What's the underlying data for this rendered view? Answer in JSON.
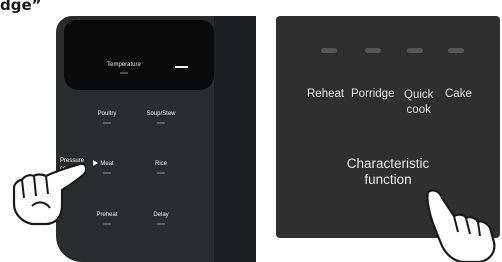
{
  "heading": "dge”",
  "left_panel": {
    "display": {
      "temperature_label": "Temperature"
    },
    "buttons": {
      "poultry": "Poultry",
      "soup_stew": "Soup/Stew",
      "meat": "Meat",
      "rice": "Rice",
      "preheat": "Preheat",
      "delay": "Delay",
      "pressure_cooker": "Pressure\ncooker"
    },
    "hand_icon": "pointing-hand-icon",
    "arrow_icon": "play-arrow-icon"
  },
  "right_panel": {
    "functions": [
      {
        "label": "Reheat"
      },
      {
        "label": "Porridge"
      },
      {
        "label": "Quick\ncook"
      },
      {
        "label": "Cake"
      }
    ],
    "characteristic_label": "Characteristic\nfunction",
    "hand_icon": "pointing-hand-icon"
  }
}
